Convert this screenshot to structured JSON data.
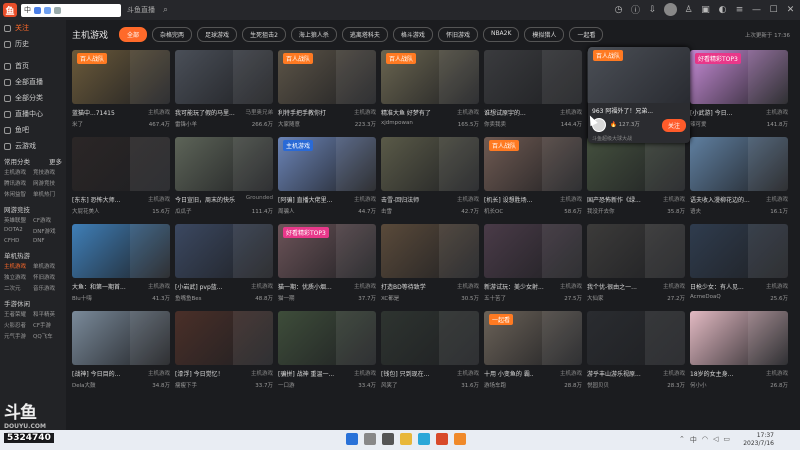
{
  "topbar": {
    "address_text": "中",
    "title": "斗鱼直播",
    "search_icon": "search-icon"
  },
  "sidebar": {
    "items": [
      {
        "label": "关注",
        "active": true
      },
      {
        "label": "历史",
        "active": false
      },
      {
        "label": "",
        "active": false
      },
      {
        "label": "首页",
        "active": false
      },
      {
        "label": "全部直播",
        "active": false
      },
      {
        "label": "全部分类",
        "active": false
      },
      {
        "label": "直播中心",
        "active": false
      },
      {
        "label": "鱼吧",
        "active": false
      },
      {
        "label": "云游戏",
        "active": false
      }
    ],
    "sections": [
      {
        "head": "常用分类",
        "more": "更多",
        "subs": [
          "主机游戏",
          "竞技游戏",
          "腾讯游戏",
          "网游竞技",
          "休闲益智",
          "单机热门"
        ]
      },
      {
        "head": "网游竞技",
        "more": "",
        "subs": [
          "英雄联盟",
          "CF游戏",
          "DOTA2",
          "DNF游戏",
          "CFHD",
          "DNF"
        ]
      },
      {
        "head": "单机热游",
        "more": "",
        "subs": [
          "主机游戏",
          "单机游戏",
          "独立游戏",
          "怀旧游戏",
          "二次元",
          "音乐游戏"
        ]
      },
      {
        "head": "手游休闲",
        "more": "",
        "subs": [
          "王者荣耀",
          "和平精英",
          "火影忍者",
          "CF手游",
          "元气手游",
          "QQ飞车"
        ]
      }
    ],
    "brand": "斗鱼",
    "brand_sub": "DOUYU.COM"
  },
  "category": {
    "title": "主机游戏",
    "tags": [
      {
        "label": "全部",
        "on": true
      },
      {
        "label": "杂格完两",
        "on": false
      },
      {
        "label": "足球游戏",
        "on": false
      },
      {
        "label": "生死狙击2",
        "on": false
      },
      {
        "label": "海上狼人杀",
        "on": false
      },
      {
        "label": "逃离塔科夫",
        "on": false
      },
      {
        "label": "格斗游戏",
        "on": false
      },
      {
        "label": "怀旧游戏",
        "on": false
      },
      {
        "label": "NBA2K",
        "on": false
      },
      {
        "label": "模拟猎人",
        "on": false
      },
      {
        "label": "一起看",
        "on": false
      }
    ],
    "update": "上次更新于 17:36"
  },
  "rooms": [
    {
      "title": "蓝猫中...71415",
      "tag": "主机游戏",
      "user": "米了",
      "hot": "467.4万",
      "badge": "百人战队",
      "badge_type": "orange",
      "bg": "#6b5a3a"
    },
    {
      "title": "我可能玩了假的马里...",
      "tag": "马里奥兄弟",
      "user": "雷锋小羊",
      "hot": "266.6万",
      "badge": "",
      "badge_type": "",
      "bg": "#4a4f58"
    },
    {
      "title": "利特手把手教你打",
      "tag": "主机游戏",
      "user": "大家随意",
      "hot": "223.3万",
      "badge": "百人战队",
      "badge_type": "orange",
      "bg": "#5c5447"
    },
    {
      "title": "精准大鱼 好梦有了",
      "tag": "主机游戏",
      "user": "xjdmpowan",
      "hot": "165.5万",
      "badge": "百人战队",
      "badge_type": "orange",
      "bg": "#6a6550"
    },
    {
      "title": "谁想试原宇的...",
      "tag": "主机游戏",
      "user": "你卖我卖",
      "hot": "144.4万",
      "badge": "",
      "badge_type": "",
      "bg": "#3a3b3e"
    },
    {
      "title": "963 阿福外了！兄弟...",
      "tag": "",
      "user": "",
      "hot": "",
      "badge": "百人战队",
      "badge_type": "orange",
      "bg": "#4b4f56"
    },
    {
      "title": "[小武游] 今日...",
      "tag": "主机游戏",
      "user": "辣可爱",
      "hot": "141.8万",
      "badge": "好看精彩TOP3",
      "badge_type": "pink",
      "bg": "#c68bd6"
    },
    {
      "title": "[东东] 恐怖大师...",
      "tag": "主机游戏",
      "user": "大屁花美人",
      "hot": "15.6万",
      "badge": "",
      "badge_type": "",
      "bg": "#2b2626"
    },
    {
      "title": "今日宣旧，周末的快乐",
      "tag": "Grounded",
      "user": "瓜瓜子",
      "hot": "111.4万",
      "badge": "",
      "badge_type": "",
      "bg": "#5d6458"
    },
    {
      "title": "[阿骗] 直播大佬里...",
      "tag": "主机游戏",
      "user": "周骗人",
      "hot": "44.7万",
      "badge": "主机游戏",
      "badge_type": "blue",
      "bg": "#6b84b7"
    },
    {
      "title": "击雪-回归法师",
      "tag": "主机游戏",
      "user": "击雪",
      "hot": "42.7万",
      "badge": "",
      "badge_type": "",
      "bg": "#5a5a48"
    },
    {
      "title": "[机长] 设想胜场...",
      "tag": "主机游戏",
      "user": "机长OC",
      "hot": "58.6万",
      "badge": "百人战队",
      "badge_type": "orange",
      "bg": "#6f5a52"
    },
    {
      "title": "国产恐怖新作《绿...",
      "tag": "主机游戏",
      "user": "我没开去你",
      "hot": "35.8万",
      "badge": "",
      "badge_type": "",
      "bg": "#44503e"
    },
    {
      "title": "语夫收入漫柳花边的...",
      "tag": "主机游戏",
      "user": "语夫",
      "hot": "16.1万",
      "badge": "",
      "badge_type": "",
      "bg": "#5f7fa0"
    },
    {
      "title": "大鱼：和第一期首...",
      "tag": "主机游戏",
      "user": "Blu十嗨",
      "hot": "41.3万",
      "badge": "",
      "badge_type": "",
      "bg": "#3f7fb8"
    },
    {
      "title": "[小岩武] pvp蓝...",
      "tag": "主机游戏",
      "user": "鱼嘴鱼Bes",
      "hot": "48.8万",
      "badge": "",
      "badge_type": "",
      "bg": "#3b4861"
    },
    {
      "title": "猫一期：优质小烟...",
      "tag": "主机游戏",
      "user": "猫一期",
      "hot": "37.7万",
      "badge": "好看精彩TOP3",
      "badge_type": "pink",
      "bg": "#6b5358"
    },
    {
      "title": "打造BD等待致学",
      "tag": "主机游戏",
      "user": "XC都是",
      "hot": "30.5万",
      "badge": "",
      "badge_type": "",
      "bg": "#5a4a3a"
    },
    {
      "title": "新游试玩：美少女射...",
      "tag": "主机游戏",
      "user": "五十苦了",
      "hot": "27.5万",
      "badge": "",
      "badge_type": "",
      "bg": "#4a3b48"
    },
    {
      "title": "我个优-很由之一...",
      "tag": "主机游戏",
      "user": "大仙家",
      "hot": "27.2万",
      "badge": "",
      "badge_type": "",
      "bg": "#3c3b3a"
    },
    {
      "title": "日枪少女：有人见...",
      "tag": "主机游戏",
      "user": "AcmeDoaQ",
      "hot": "25.6万",
      "badge": "",
      "badge_type": "",
      "bg": "#2f3c4e"
    },
    {
      "title": "[战神] 今日目的...",
      "tag": "主机游戏",
      "user": "Dela大鼓",
      "hot": "34.8万",
      "badge": "",
      "badge_type": "",
      "bg": "#7a8a9a"
    },
    {
      "title": "[漆浮] 今日觉忆！",
      "tag": "主机游戏",
      "user": "瘦瘦下手",
      "hot": "33.7万",
      "badge": "",
      "badge_type": "",
      "bg": "#4a2f28"
    },
    {
      "title": "[骗拼] 战神 重温一...",
      "tag": "主机游戏",
      "user": "一口游",
      "hot": "33.4万",
      "badge": "",
      "badge_type": "",
      "bg": "#3e4d3a"
    },
    {
      "title": "[钱包] 只到现在...",
      "tag": "主机游戏",
      "user": "风笑了",
      "hot": "31.6万",
      "badge": "",
      "badge_type": "",
      "bg": "#2e3430"
    },
    {
      "title": "十用 小变鱼的 霸..",
      "tag": "主机游戏",
      "user": "游场车跑",
      "hot": "28.8万",
      "badge": "一起看",
      "badge_type": "orange",
      "bg": "#6b6258"
    },
    {
      "title": "游乎丰山游乐视原...",
      "tag": "主机游戏",
      "user": "悦园贝贝",
      "hot": "28.3万",
      "badge": "",
      "badge_type": "",
      "bg": "#2a2c30"
    },
    {
      "title": "18岁的女主身...",
      "tag": "主机游戏",
      "user": "何小小",
      "hot": "26.8万",
      "badge": "",
      "badge_type": "",
      "bg": "#e2b9c2"
    }
  ],
  "popup": {
    "title": "963 阿福外了！兄弟...",
    "views": "127.3万",
    "follow": "关注",
    "foot": "斗鱼超级大球大战"
  },
  "taskbar": {
    "room_id": "5324740",
    "time": "17:37",
    "date": "2023/7/16"
  }
}
